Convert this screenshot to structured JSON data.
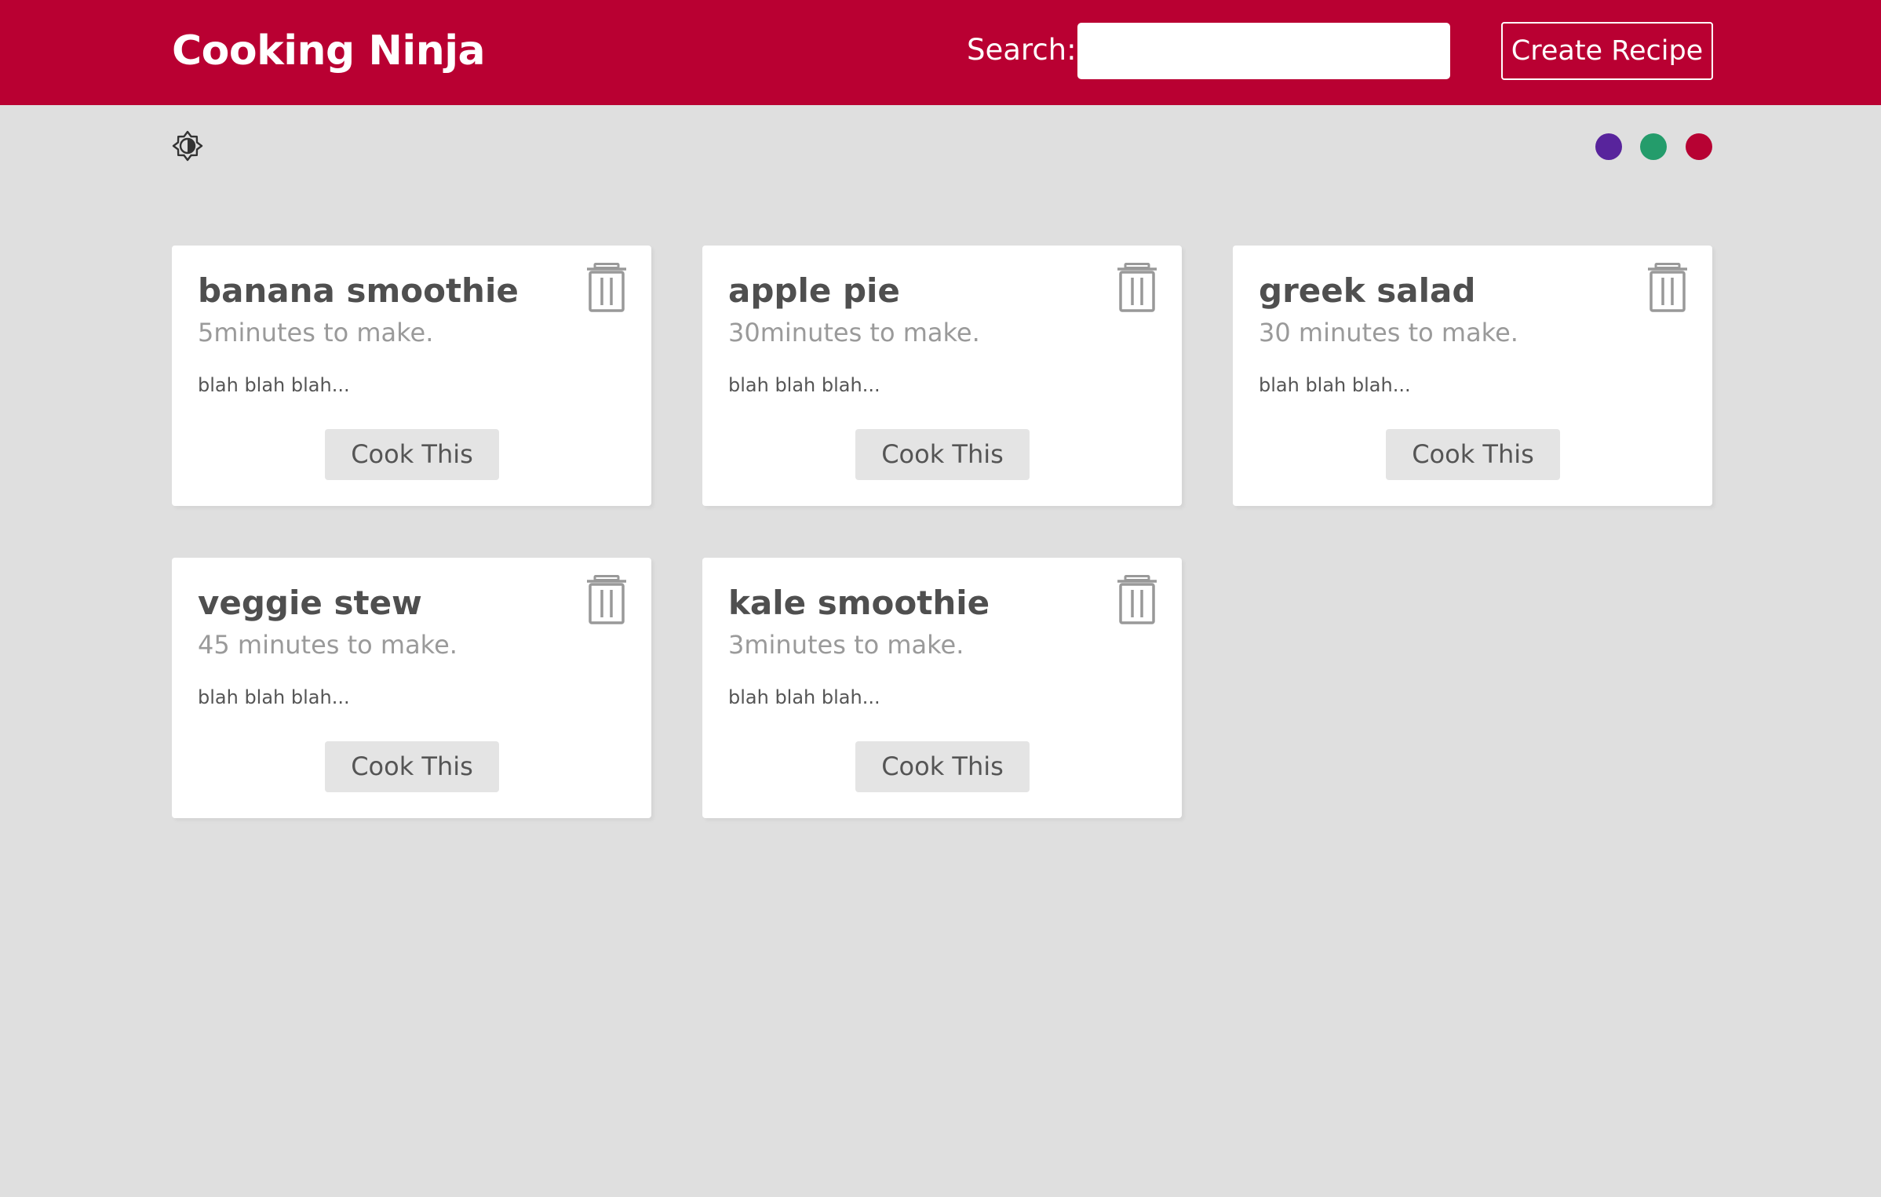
{
  "navbar": {
    "brand": "Cooking Ninja",
    "search_label": "Search:",
    "search_value": "",
    "search_placeholder": "",
    "create_label": "Create Recipe",
    "background_color": "#b90032"
  },
  "theme": {
    "mode_toggle_icon": "brightness-icon",
    "swatches": [
      {
        "name": "purple",
        "color": "#58249c"
      },
      {
        "name": "green",
        "color": "#249c6b"
      },
      {
        "name": "red",
        "color": "#b70233"
      }
    ]
  },
  "recipes": [
    {
      "title": "banana smoothie",
      "time": "5minutes to make.",
      "desc": "blah blah blah...",
      "button": "Cook This"
    },
    {
      "title": "apple pie",
      "time": "30minutes to make.",
      "desc": "blah blah blah...",
      "button": "Cook This"
    },
    {
      "title": "greek salad",
      "time": "30 minutes to make.",
      "desc": "blah blah blah...",
      "button": "Cook This"
    },
    {
      "title": "veggie stew",
      "time": "45 minutes to make.",
      "desc": "blah blah blah...",
      "button": "Cook This"
    },
    {
      "title": "kale smoothie",
      "time": "3minutes to make.",
      "desc": "blah blah blah...",
      "button": "Cook This"
    }
  ]
}
